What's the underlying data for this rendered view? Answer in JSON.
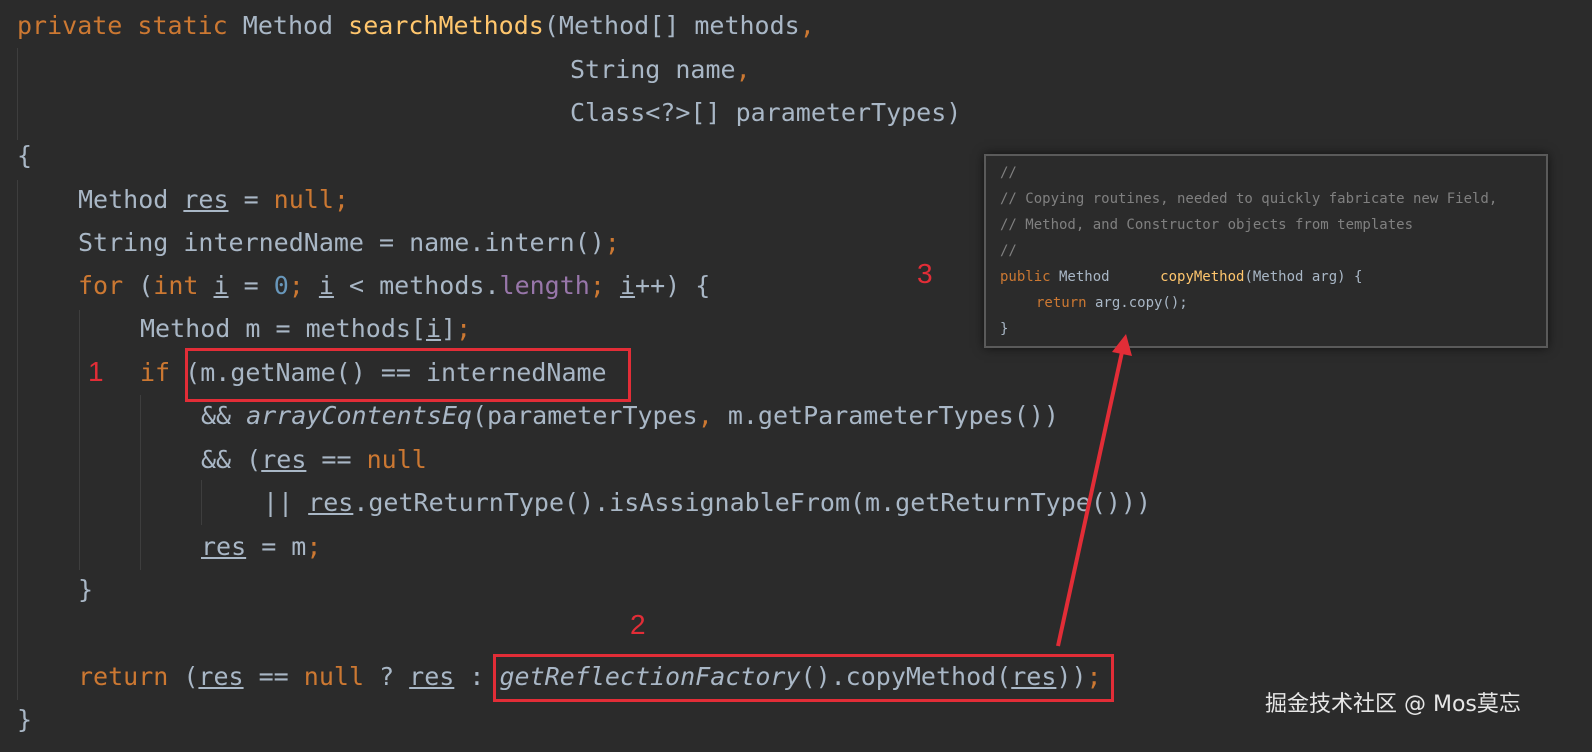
{
  "code": {
    "line1": {
      "k1": "private",
      "k2": "static",
      "type": "Method",
      "fn": "searchMethods",
      "open": "(Method[] methods",
      "comma": ","
    },
    "line2": {
      "text": "String name",
      "comma": ","
    },
    "line3": {
      "text": "Class<?>[] parameterTypes)"
    },
    "line4": {
      "brace": "{"
    },
    "line5": {
      "t1": "Method ",
      "res": "res",
      "t2": " = ",
      "null": "null",
      "semi": ";"
    },
    "line6": {
      "t1": "String internedName = name.intern()",
      "semi": ";"
    },
    "line7": {
      "for": "for",
      "t1": " (",
      "int": "int",
      "t2": " ",
      "i1": "i",
      "t3": " = ",
      "zero": "0",
      "semi1": ";",
      "t4": " ",
      "i2": "i",
      "t5": " < methods.",
      "length": "length",
      "semi2": ";",
      "t6": " ",
      "i3": "i",
      "t7": "++) {"
    },
    "line8": {
      "t1": "Method m = methods[",
      "i": "i",
      "t2": "]",
      "semi": ";"
    },
    "line9": {
      "if": "if",
      "t1": " (m.getName() == internedName"
    },
    "line10": {
      "t1": "&& ",
      "fn": "arrayContentsEq",
      "t2": "(parameterTypes",
      "comma": ",",
      "t3": " m.getParameterTypes())"
    },
    "line11": {
      "t1": "&& (",
      "res": "res",
      "t2": " == ",
      "null": "null"
    },
    "line12": {
      "t1": "|| ",
      "res": "res",
      "t2": ".getReturnType().isAssignableFrom(m.getReturnType()))"
    },
    "line13": {
      "res": "res",
      "t1": " = m",
      "semi": ";"
    },
    "line14": {
      "brace": "}"
    },
    "line15": {
      "ret": "return",
      "t1": " (",
      "res1": "res",
      "t2": " == ",
      "null": "null",
      "t3": " ? ",
      "res2": "res",
      "t4": " : ",
      "fn": "getReflectionFactory",
      "t5": "().copyMethod(",
      "res3": "res",
      "t6": "))",
      "semi": ";"
    },
    "line16": {
      "brace": "}"
    }
  },
  "popup": {
    "c1": "//",
    "c2": "// Copying routines, needed to quickly fabricate new Field,",
    "c3": "// Method, and Constructor objects from templates",
    "c4": "//",
    "sig": {
      "pub": "public",
      "type": " Method      ",
      "fn": "copyMethod",
      "args": "(Method arg) {"
    },
    "body": {
      "ret": "return",
      "t": " arg.copy();"
    },
    "close": "}"
  },
  "annotations": {
    "n1": "1",
    "n2": "2",
    "n3": "3"
  },
  "watermark": "掘金技术社区 @ Mos莫忘",
  "colors": {
    "annotation": "#e22d37",
    "background": "#2b2b2b",
    "keyword": "#cc7832",
    "function": "#ffc66d",
    "number": "#6897bb",
    "field": "#9876aa",
    "text": "#a9b7c6"
  }
}
